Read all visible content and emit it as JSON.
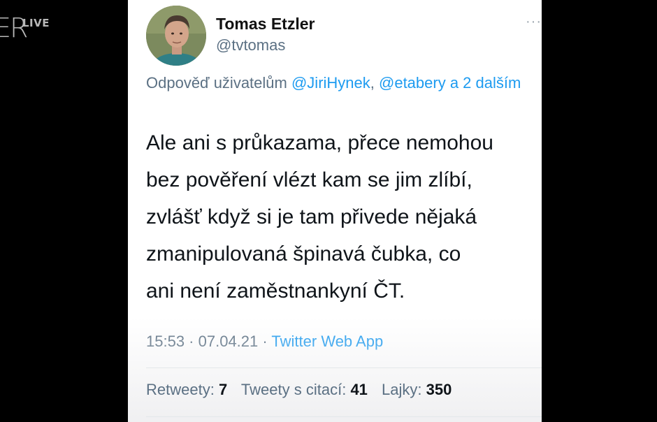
{
  "overlay": {
    "logo_text": "ER",
    "live_label": "LIVE"
  },
  "tweet": {
    "author_name": "Tomas Etzler",
    "author_handle": "@tvtomas",
    "more_icon": "ellipsis-icon",
    "reply_prefix": "Odpověď uživatelům ",
    "reply_mention_1": "@JiriHynek",
    "reply_sep": ", ",
    "reply_mention_2": "@etabery",
    "reply_suffix": " a 2 dalším",
    "text_lines": [
      "Ale ani s průkazama, přece nemohou",
      "bez pověření vlézt kam se jim zlíbí,",
      "zvlášť když si je tam přivede nějaká",
      "zmanipulovaná špinavá čubka, co",
      "ani není zaměstnankyní ČT."
    ],
    "time": "15:53",
    "date": "07.04.21",
    "meta_sep": " · ",
    "source": "Twitter Web App",
    "stats": {
      "retweets_label": "Retweety:",
      "retweets_value": "7",
      "quotes_label": "Tweety s citací:",
      "quotes_value": "41",
      "likes_label": "Lajky:",
      "likes_value": "350"
    }
  },
  "colors": {
    "link": "#1d9bf0",
    "secondary": "#5b7083",
    "text": "#0f1419"
  }
}
